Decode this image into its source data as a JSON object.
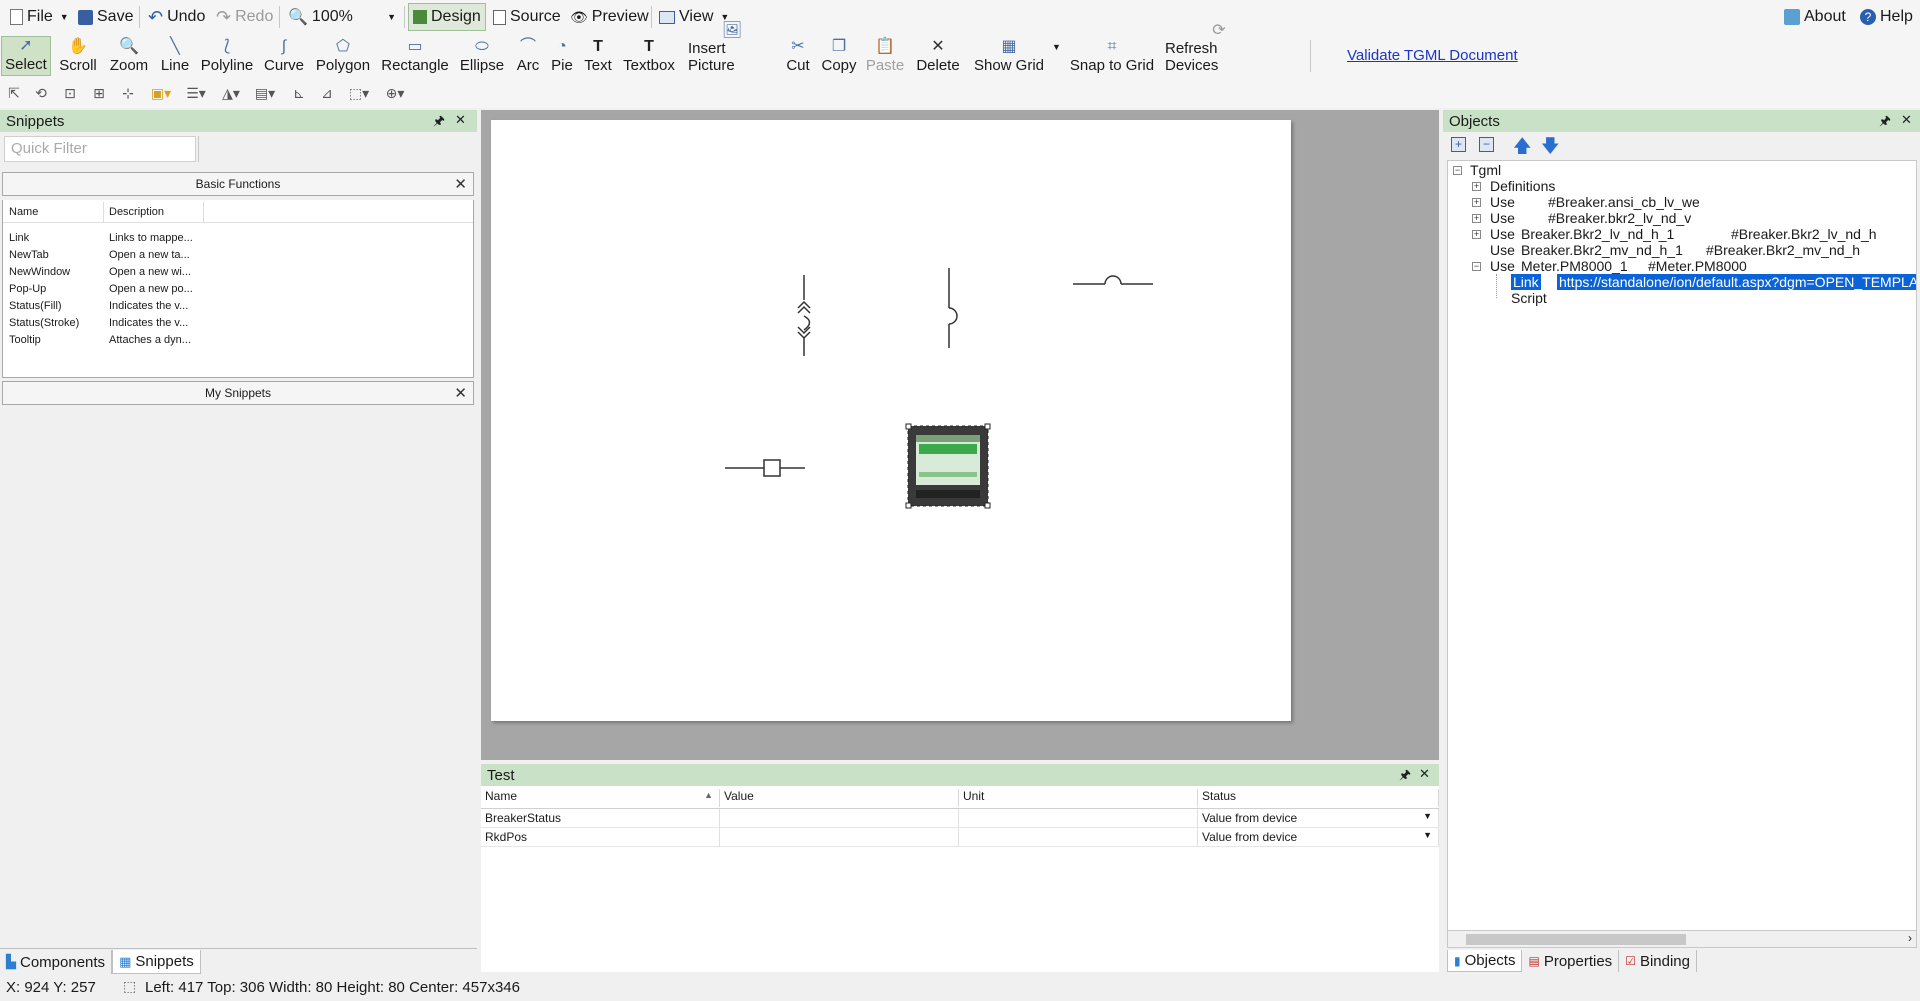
{
  "menu": {
    "file": "File",
    "save": "Save",
    "undo": "Undo",
    "redo": "Redo",
    "zoom": "100%",
    "design": "Design",
    "source": "Source",
    "preview": "Preview",
    "view": "View",
    "about": "About",
    "help": "Help"
  },
  "tools": {
    "select": "Select",
    "scroll": "Scroll",
    "zoom": "Zoom",
    "line": "Line",
    "polyline": "Polyline",
    "curve": "Curve",
    "polygon": "Polygon",
    "rectangle": "Rectangle",
    "ellipse": "Ellipse",
    "arc": "Arc",
    "pie": "Pie",
    "text": "Text",
    "textbox": "Textbox",
    "insert_picture": "Insert Picture",
    "cut": "Cut",
    "copy": "Copy",
    "paste": "Paste",
    "delete": "Delete",
    "show_grid": "Show Grid",
    "snap_to_grid": "Snap to Grid",
    "refresh_devices": "Refresh Devices",
    "validate": "Validate TGML Document"
  },
  "snippets": {
    "title": "Snippets",
    "filter_placeholder": "Quick Filter",
    "basic_functions": "Basic Functions",
    "col_name": "Name",
    "col_description": "Description",
    "rows": [
      {
        "name": "Link",
        "description": "Links to mappe..."
      },
      {
        "name": "NewTab",
        "description": "Open a new ta..."
      },
      {
        "name": "NewWindow",
        "description": "Open a new wi..."
      },
      {
        "name": "Pop-Up",
        "description": "Open a new po..."
      },
      {
        "name": "Status(Fill)",
        "description": "Indicates the v..."
      },
      {
        "name": "Status(Stroke)",
        "description": "Indicates the v..."
      },
      {
        "name": "Tooltip",
        "description": "Attaches a dyn..."
      }
    ],
    "my_snippets": "My Snippets",
    "tab_components": "Components",
    "tab_snippets": "Snippets"
  },
  "test": {
    "title": "Test",
    "col_name": "Name",
    "col_value": "Value",
    "col_unit": "Unit",
    "col_status": "Status",
    "rows": [
      {
        "name": "BreakerStatus",
        "value": "",
        "unit": "",
        "status": "Value from device"
      },
      {
        "name": "RkdPos",
        "value": "",
        "unit": "",
        "status": "Value from device"
      }
    ]
  },
  "objects": {
    "title": "Objects",
    "tree": {
      "root": "Tgml",
      "definitions": "Definitions",
      "use1_label": "Use",
      "use1_ref": "#Breaker.ansi_cb_lv_we",
      "use2_label": "Use",
      "use2_ref": "#Breaker.bkr2_lv_nd_v",
      "use3_label": "Use",
      "use3_name": "Breaker.Bkr2_lv_nd_h_1",
      "use3_ref": "#Breaker.Bkr2_lv_nd_h",
      "use4_label": "Use",
      "use4_name": "Breaker.Bkr2_mv_nd_h_1",
      "use4_ref": "#Breaker.Bkr2_mv_nd_h",
      "use5_label": "Use",
      "use5_name": "Meter.PM8000_1",
      "use5_ref": "#Meter.PM8000",
      "link_label": "Link",
      "link_url": "https://standalone/ion/default.aspx?dgm=OPEN_TEMPLATE",
      "script_label": "Script"
    },
    "tab_objects": "Objects",
    "tab_properties": "Properties",
    "tab_binding": "Binding"
  },
  "status": {
    "cursor": "X: 924  Y: 257",
    "selection": "Left: 417  Top: 306  Width: 80  Height: 80  Center: 457x346"
  }
}
